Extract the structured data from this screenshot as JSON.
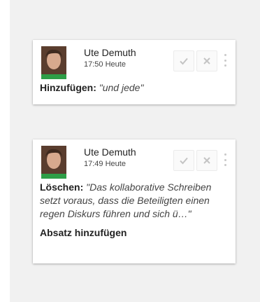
{
  "comments": [
    {
      "author": "Ute Demuth",
      "time": "17:50 Heute",
      "action_label": "Hinzufügen:",
      "quote": "\"und jede\""
    },
    {
      "author": "Ute Demuth",
      "time": "17:49 Heute",
      "action_label": "Löschen:",
      "quote": "\"Das kollaborative Schreiben setzt voraus, dass die Beteiligten einen regen Diskurs führen und sich ü…\"",
      "extra": "Absatz hinzufügen"
    }
  ],
  "icons": {
    "accept": "checkmark-icon",
    "reject": "close-icon",
    "more": "more-vertical-icon"
  },
  "colors": {
    "avatar_accent": "#2e9e47",
    "icon_gray": "#c4c4c4"
  }
}
